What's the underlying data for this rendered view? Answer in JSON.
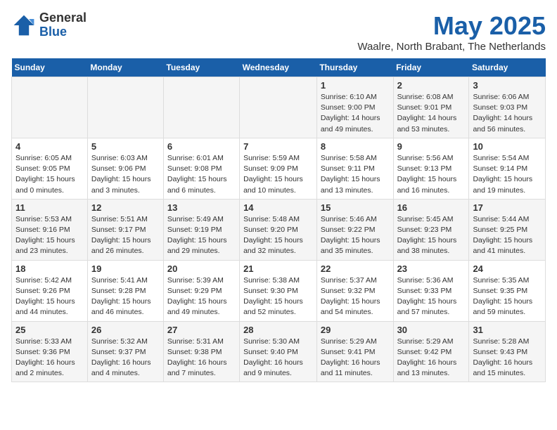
{
  "logo": {
    "general": "General",
    "blue": "Blue"
  },
  "title": "May 2025",
  "location": "Waalre, North Brabant, The Netherlands",
  "days_header": [
    "Sunday",
    "Monday",
    "Tuesday",
    "Wednesday",
    "Thursday",
    "Friday",
    "Saturday"
  ],
  "weeks": [
    [
      {
        "day": "",
        "info": ""
      },
      {
        "day": "",
        "info": ""
      },
      {
        "day": "",
        "info": ""
      },
      {
        "day": "",
        "info": ""
      },
      {
        "day": "1",
        "info": "Sunrise: 6:10 AM\nSunset: 9:00 PM\nDaylight: 14 hours\nand 49 minutes."
      },
      {
        "day": "2",
        "info": "Sunrise: 6:08 AM\nSunset: 9:01 PM\nDaylight: 14 hours\nand 53 minutes."
      },
      {
        "day": "3",
        "info": "Sunrise: 6:06 AM\nSunset: 9:03 PM\nDaylight: 14 hours\nand 56 minutes."
      }
    ],
    [
      {
        "day": "4",
        "info": "Sunrise: 6:05 AM\nSunset: 9:05 PM\nDaylight: 15 hours\nand 0 minutes."
      },
      {
        "day": "5",
        "info": "Sunrise: 6:03 AM\nSunset: 9:06 PM\nDaylight: 15 hours\nand 3 minutes."
      },
      {
        "day": "6",
        "info": "Sunrise: 6:01 AM\nSunset: 9:08 PM\nDaylight: 15 hours\nand 6 minutes."
      },
      {
        "day": "7",
        "info": "Sunrise: 5:59 AM\nSunset: 9:09 PM\nDaylight: 15 hours\nand 10 minutes."
      },
      {
        "day": "8",
        "info": "Sunrise: 5:58 AM\nSunset: 9:11 PM\nDaylight: 15 hours\nand 13 minutes."
      },
      {
        "day": "9",
        "info": "Sunrise: 5:56 AM\nSunset: 9:13 PM\nDaylight: 15 hours\nand 16 minutes."
      },
      {
        "day": "10",
        "info": "Sunrise: 5:54 AM\nSunset: 9:14 PM\nDaylight: 15 hours\nand 19 minutes."
      }
    ],
    [
      {
        "day": "11",
        "info": "Sunrise: 5:53 AM\nSunset: 9:16 PM\nDaylight: 15 hours\nand 23 minutes."
      },
      {
        "day": "12",
        "info": "Sunrise: 5:51 AM\nSunset: 9:17 PM\nDaylight: 15 hours\nand 26 minutes."
      },
      {
        "day": "13",
        "info": "Sunrise: 5:49 AM\nSunset: 9:19 PM\nDaylight: 15 hours\nand 29 minutes."
      },
      {
        "day": "14",
        "info": "Sunrise: 5:48 AM\nSunset: 9:20 PM\nDaylight: 15 hours\nand 32 minutes."
      },
      {
        "day": "15",
        "info": "Sunrise: 5:46 AM\nSunset: 9:22 PM\nDaylight: 15 hours\nand 35 minutes."
      },
      {
        "day": "16",
        "info": "Sunrise: 5:45 AM\nSunset: 9:23 PM\nDaylight: 15 hours\nand 38 minutes."
      },
      {
        "day": "17",
        "info": "Sunrise: 5:44 AM\nSunset: 9:25 PM\nDaylight: 15 hours\nand 41 minutes."
      }
    ],
    [
      {
        "day": "18",
        "info": "Sunrise: 5:42 AM\nSunset: 9:26 PM\nDaylight: 15 hours\nand 44 minutes."
      },
      {
        "day": "19",
        "info": "Sunrise: 5:41 AM\nSunset: 9:28 PM\nDaylight: 15 hours\nand 46 minutes."
      },
      {
        "day": "20",
        "info": "Sunrise: 5:39 AM\nSunset: 9:29 PM\nDaylight: 15 hours\nand 49 minutes."
      },
      {
        "day": "21",
        "info": "Sunrise: 5:38 AM\nSunset: 9:30 PM\nDaylight: 15 hours\nand 52 minutes."
      },
      {
        "day": "22",
        "info": "Sunrise: 5:37 AM\nSunset: 9:32 PM\nDaylight: 15 hours\nand 54 minutes."
      },
      {
        "day": "23",
        "info": "Sunrise: 5:36 AM\nSunset: 9:33 PM\nDaylight: 15 hours\nand 57 minutes."
      },
      {
        "day": "24",
        "info": "Sunrise: 5:35 AM\nSunset: 9:35 PM\nDaylight: 15 hours\nand 59 minutes."
      }
    ],
    [
      {
        "day": "25",
        "info": "Sunrise: 5:33 AM\nSunset: 9:36 PM\nDaylight: 16 hours\nand 2 minutes."
      },
      {
        "day": "26",
        "info": "Sunrise: 5:32 AM\nSunset: 9:37 PM\nDaylight: 16 hours\nand 4 minutes."
      },
      {
        "day": "27",
        "info": "Sunrise: 5:31 AM\nSunset: 9:38 PM\nDaylight: 16 hours\nand 7 minutes."
      },
      {
        "day": "28",
        "info": "Sunrise: 5:30 AM\nSunset: 9:40 PM\nDaylight: 16 hours\nand 9 minutes."
      },
      {
        "day": "29",
        "info": "Sunrise: 5:29 AM\nSunset: 9:41 PM\nDaylight: 16 hours\nand 11 minutes."
      },
      {
        "day": "30",
        "info": "Sunrise: 5:29 AM\nSunset: 9:42 PM\nDaylight: 16 hours\nand 13 minutes."
      },
      {
        "day": "31",
        "info": "Sunrise: 5:28 AM\nSunset: 9:43 PM\nDaylight: 16 hours\nand 15 minutes."
      }
    ]
  ]
}
